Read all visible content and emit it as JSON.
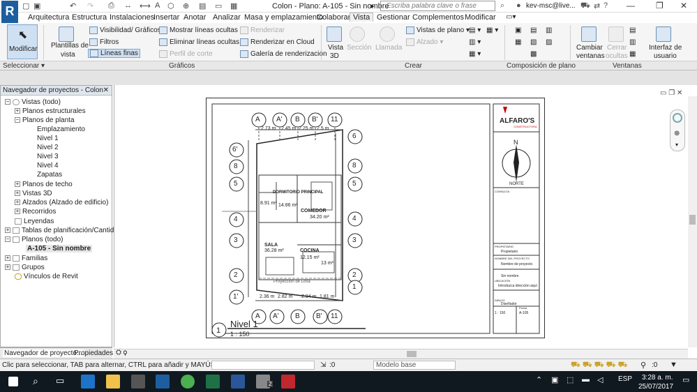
{
  "titlebar": {
    "doc_title": "Colon - Plano: A-105 - Sin nombre",
    "search_placeholder": "Escriba palabra clave o frase",
    "user": "kev-msc@live...",
    "logo_letter": "R",
    "help": "?"
  },
  "tabs": [
    "Arquitectura",
    "Estructura",
    "Instalaciones",
    "Insertar",
    "Anotar",
    "Analizar",
    "Masa y emplazamiento",
    "Colaborar",
    "Vista",
    "Gestionar",
    "Complementos",
    "Modificar"
  ],
  "active_tab": "Vista",
  "ribbon": {
    "modificar": "Modificar",
    "plantillas": [
      "Plantillas de",
      "vista"
    ],
    "visibilidad": "Visibilidad/ Gráficos",
    "filtros": "Filtros",
    "lineas_finas": "Líneas finas",
    "mostrar_lineas": "Mostrar líneas ocultas",
    "eliminar_lineas": "Eliminar líneas ocultas",
    "perfil_corte": "Perfil de corte",
    "renderizar": "Renderizar",
    "renderizar_cloud": "Renderizar  en Cloud",
    "galeria": "Galería de  renderización",
    "vista3d": [
      "Vista",
      "3D"
    ],
    "seccion": "Sección",
    "llamada": "Llamada",
    "vistas_plano": "Vistas de plano",
    "alzado": "Alzado",
    "cambiar_ventanas": [
      "Cambiar",
      "ventanas"
    ],
    "cerrar_ocultas": [
      "Cerrar",
      "ocultas"
    ],
    "interfaz": [
      "Interfaz de",
      "usuario"
    ]
  },
  "panels": {
    "seleccionar": "Seleccionar",
    "graficos": "Gráficos",
    "crear": "Crear",
    "composicion": "Composición de plano",
    "ventanas": "Ventanas"
  },
  "browser": {
    "title": "Navegador de proyectos - Colon",
    "items": [
      {
        "label": "Vistas (todo)",
        "toggle": "-"
      },
      {
        "label": "Planos estructurales",
        "toggle": "+"
      },
      {
        "label": "Planos de planta",
        "toggle": "-"
      },
      {
        "label": "Emplazamiento",
        "toggle": ""
      },
      {
        "label": "Nivel 1",
        "toggle": ""
      },
      {
        "label": "Nivel 2",
        "toggle": ""
      },
      {
        "label": "Nivel 3",
        "toggle": ""
      },
      {
        "label": "Nivel 4",
        "toggle": ""
      },
      {
        "label": "Zapatas",
        "toggle": ""
      },
      {
        "label": "Planos de techo",
        "toggle": "+"
      },
      {
        "label": "Vistas 3D",
        "toggle": "+"
      },
      {
        "label": "Alzados (Alzado de edificio)",
        "toggle": "+"
      },
      {
        "label": "Recorridos",
        "toggle": "+"
      },
      {
        "label": "Leyendas",
        "toggle": ""
      },
      {
        "label": "Tablas de planificación/Cantidad",
        "toggle": "+"
      },
      {
        "label": "Planos (todo)",
        "toggle": "-"
      },
      {
        "label": "A-105 - Sin nombre",
        "toggle": ""
      },
      {
        "label": "Familias",
        "toggle": "+"
      },
      {
        "label": "Grupos",
        "toggle": "+"
      },
      {
        "label": "Vínculos de Revit",
        "toggle": ""
      }
    ],
    "tab1": "Navegador de proyecto...",
    "tab2": "Propiedades"
  },
  "drawing": {
    "grid_top": [
      "A",
      "A'",
      "B",
      "B'",
      "11"
    ],
    "grid_bottom": [
      "A",
      "A'",
      "B",
      "B'",
      "11"
    ],
    "grid_right": [
      "6",
      "8",
      "5",
      "4",
      "3",
      "2",
      "1"
    ],
    "grid_left": [
      "6'",
      "8",
      "5",
      "4",
      "3",
      "2",
      "1'"
    ],
    "dims_top": [
      "2.73 m",
      "2.45 m",
      "2.25 m",
      "2.5 m"
    ],
    "dims_bottom": [
      "2.36 m",
      "2.82 m",
      "2.94 m",
      "1.81 m"
    ],
    "dims_left": [
      "2.57 m",
      "2.97 m",
      "3.93 m",
      "3.98 m",
      "2.12 m",
      "2.94 m",
      "3.78 m",
      "2.35 m",
      "2.12 m"
    ],
    "dims_right": [
      "1.14 m",
      "1.83 m",
      "1.77 m",
      "4.73 m",
      "1.85 m",
      "2.91 m",
      "1.59 m",
      "3.86 m"
    ],
    "rooms": [
      {
        "name": "SALA",
        "area": "36.28 m²"
      },
      {
        "name": "COMEDOR",
        "area": "34.20 m²"
      },
      {
        "name": "DORMITORIO PRINCIPAL",
        "area": "14.86 m²"
      },
      {
        "name": "COCINA",
        "area": "12.15 m²"
      },
      {
        "name": "",
        "area": "8.91 m²"
      },
      {
        "name": "",
        "area": "13 m²"
      }
    ],
    "view_title": "Nivel 1",
    "view_number": "1",
    "scale": "1 : 150",
    "proj_note": "Proyección de Losa"
  },
  "titleblock": {
    "logo": "ALFARO'S",
    "logo_sub": "CONSTRUCTORA",
    "north_letter": "N",
    "north_label": "NORTE",
    "label_consulta": "CONSULTA",
    "label_propietario": "PROPIETARIO",
    "val_propietario": "Propietario",
    "label_proyecto": "NOMBRE DEL PROYECTO",
    "val_proyecto": "Nombre de proyecto",
    "val_plano": "Sin nombre",
    "label_ubicacion": "UBICACIÓN",
    "val_ubicacion": "Introduzca dirección aquí",
    "label_dibujo": "DIBUJO",
    "val_dibujo": "Diseñador",
    "val_escala": "1 : 150",
    "val_num": "A-105",
    "val_fecha": "Fecha"
  },
  "statusbar": {
    "hint": "Clic para seleccionar, TAB para alternar, CTRL para añadir y MAYÚS para a",
    "count": ":0",
    "model": "Modelo base",
    "filter": ":0"
  },
  "taskbar": {
    "lang": "ESP",
    "time": "3:28 a. m.",
    "date": "25/07/2017",
    "notif": "2"
  }
}
